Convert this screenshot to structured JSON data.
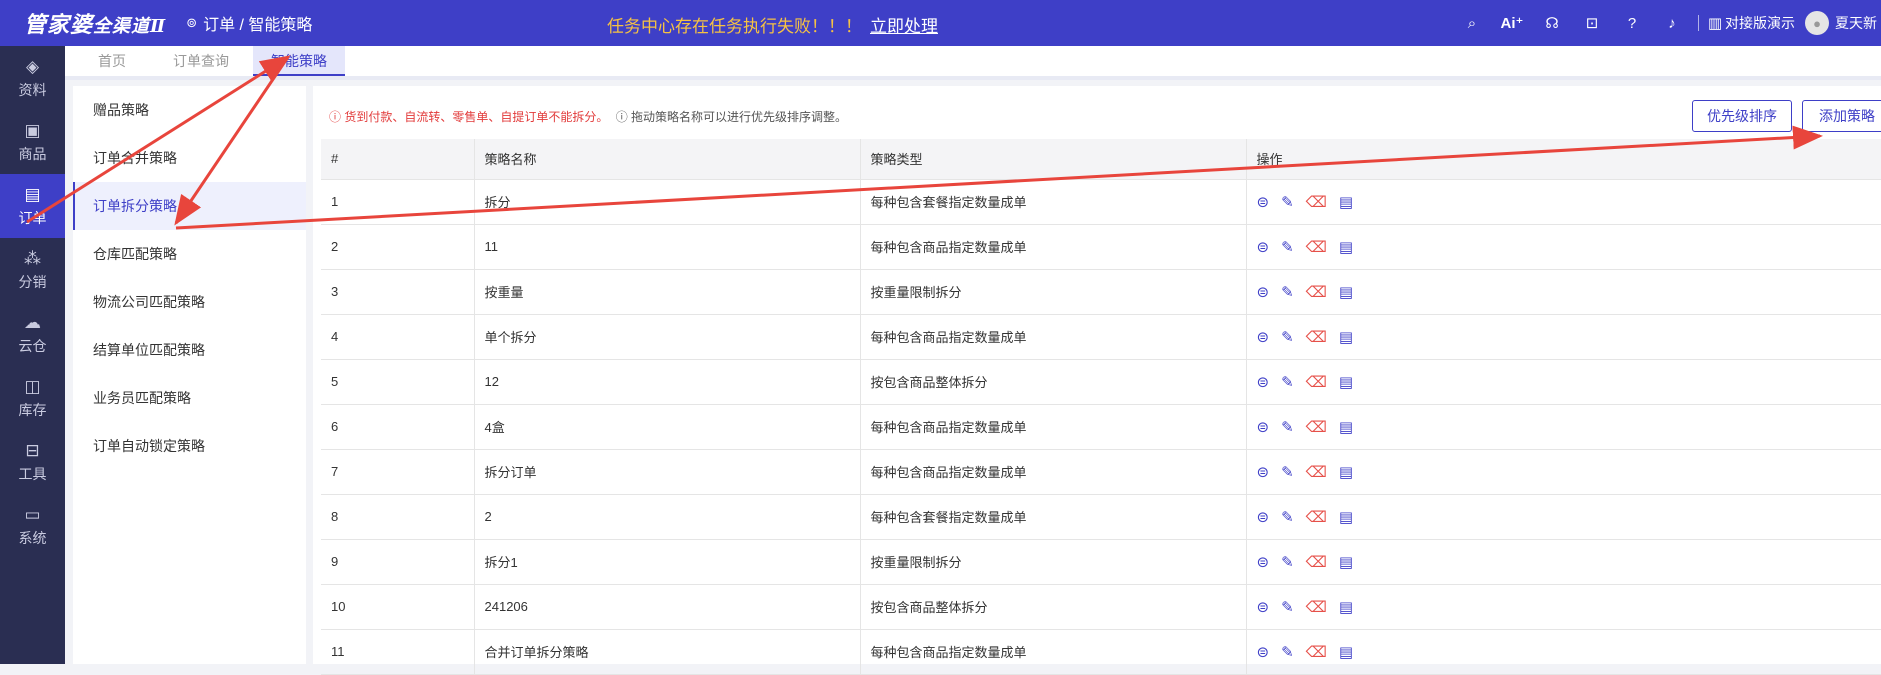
{
  "topbar": {
    "logo": "管家婆",
    "logo_sub": "全渠道Ⅱ",
    "breadcrumb": "订单 / 智能策略",
    "alert": "任务中心存在任务执行失败！！！",
    "alert_action": "立即处理",
    "demo_label": "对接版演示",
    "user_name": "夏天新"
  },
  "leftnav": [
    {
      "label": "资料",
      "icon": "layers-icon",
      "glyph": "◈"
    },
    {
      "label": "商品",
      "icon": "box-icon",
      "glyph": "▣"
    },
    {
      "label": "订单",
      "icon": "document-icon",
      "glyph": "▤"
    },
    {
      "label": "分销",
      "icon": "network-icon",
      "glyph": "⁂"
    },
    {
      "label": "云仓",
      "icon": "cloud-icon",
      "glyph": "☁"
    },
    {
      "label": "库存",
      "icon": "stack-icon",
      "glyph": "◫"
    },
    {
      "label": "工具",
      "icon": "toolbox-icon",
      "glyph": "⊟"
    },
    {
      "label": "系统",
      "icon": "monitor-icon",
      "glyph": "▭"
    }
  ],
  "tabs": [
    "首页",
    "订单查询",
    "智能策略"
  ],
  "strategies": [
    "赠品策略",
    "订单合并策略",
    "订单拆分策略",
    "仓库匹配策略",
    "物流公司匹配策略",
    "结算单位匹配策略",
    "业务员匹配策略",
    "订单自动锁定策略"
  ],
  "main": {
    "tip_warning": "ⓘ 货到付款、自流转、零售单、自提订单不能拆分。",
    "tip_info": "ⓘ 拖动策略名称可以进行优先级排序调整。",
    "btn_priority": "优先级排序",
    "btn_add": "添加策略",
    "columns": [
      "#",
      "策略名称",
      "策略类型",
      "操作"
    ],
    "rows": [
      [
        "1",
        "拆分",
        "每种包含套餐指定数量成单"
      ],
      [
        "2",
        "11",
        "每种包含商品指定数量成单"
      ],
      [
        "3",
        "按重量",
        "按重量限制拆分"
      ],
      [
        "4",
        "单个拆分",
        "每种包含商品指定数量成单"
      ],
      [
        "5",
        "12",
        "按包含商品整体拆分"
      ],
      [
        "6",
        "4盒",
        "每种包含商品指定数量成单"
      ],
      [
        "7",
        "拆分订单",
        "每种包含商品指定数量成单"
      ],
      [
        "8",
        "2",
        "每种包含套餐指定数量成单"
      ],
      [
        "9",
        "拆分1",
        "按重量限制拆分"
      ],
      [
        "10",
        "241206",
        "按包含商品整体拆分"
      ],
      [
        "11",
        "合并订单拆分策略",
        "每种包含商品指定数量成单"
      ]
    ]
  },
  "colors": {
    "primary": "#3e3fc7",
    "nav_bg": "#2a2e52",
    "alert": "#f6c243",
    "warn": "#e23b3b",
    "annotation": "#e8453c"
  }
}
